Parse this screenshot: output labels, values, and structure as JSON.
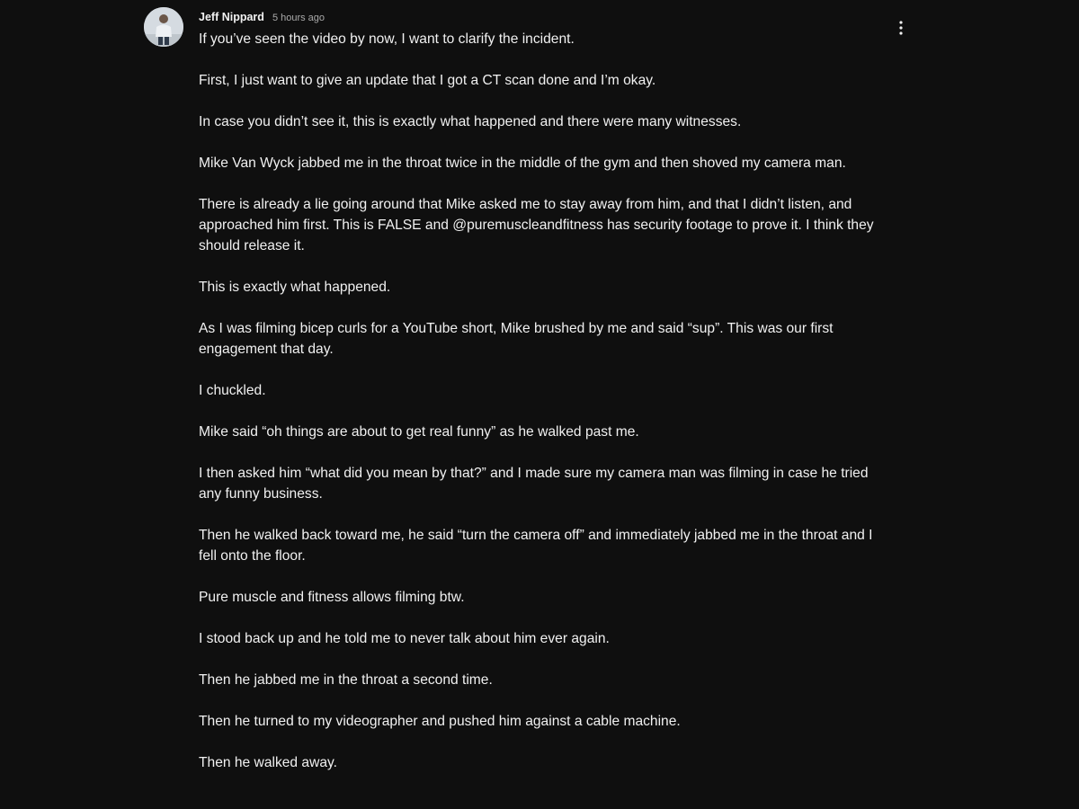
{
  "comment": {
    "author": "Jeff Nippard",
    "timestamp": "5 hours ago",
    "avatar_icon": "profile-photo",
    "menu_icon": "more-vert-icon",
    "paragraphs": [
      "If you’ve seen the video by now, I want to clarify the incident.",
      "First, I just want to give an update that I got a CT scan done and I’m okay.",
      "In case you didn’t see it, this is exactly what happened and there were many witnesses.",
      "Mike Van Wyck jabbed me in the throat twice in the middle of the gym and then shoved my camera man.",
      "There is already a lie going around that Mike asked me to stay away from him, and that I didn’t listen, and approached him first. This is FALSE and @puremuscleandfitness has security footage to prove it. I think they should release it.",
      "This is exactly what happened.",
      "As I was filming bicep curls for a YouTube short, Mike brushed by me and said “sup”. This was our first engagement that day.",
      "I chuckled.",
      "Mike said “oh things are about to get real funny” as he walked past me.",
      "I then asked him “what did you mean by that?” and I made sure my camera man was filming in case he tried any funny business.",
      "Then he walked back toward me, he said “turn the camera off” and immediately jabbed me in the throat and I fell onto the floor.",
      "Pure muscle and fitness allows filming btw.",
      "I stood back up and he told me to never talk about him ever again.",
      "Then he jabbed me in the throat a second time.",
      "Then he turned to my videographer and pushed him against a cable machine.",
      "Then he walked away."
    ]
  },
  "colors": {
    "background": "#0f0f0f",
    "text_primary": "#f1f1f1",
    "text_secondary": "#aaaaaa"
  }
}
